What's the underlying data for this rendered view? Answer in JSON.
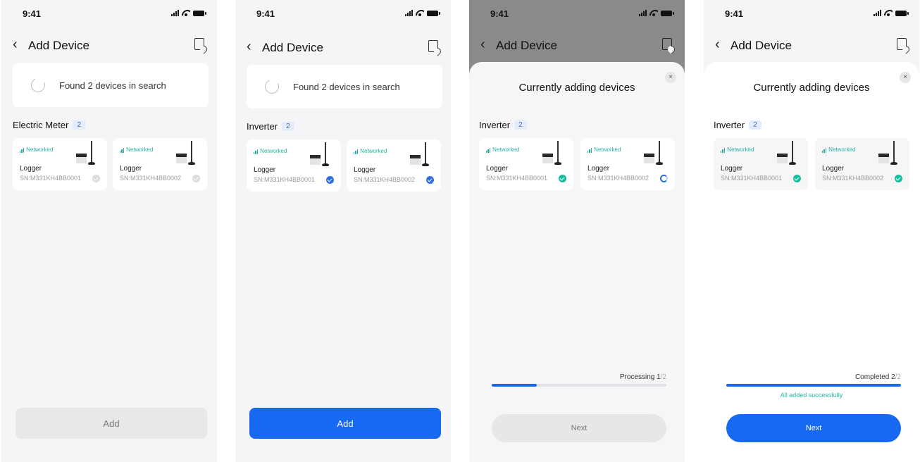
{
  "status_time": "9:41",
  "nav_title": "Add Device",
  "search_text": "Found 2 devices in search",
  "screen1": {
    "group_name": "Electric Meter",
    "group_count": "2",
    "devices": [
      {
        "status": "Networked",
        "name": "Logger",
        "sn": "SN:M331KH4BB0001",
        "state": "unselected"
      },
      {
        "status": "Networked",
        "name": "Logger",
        "sn": "SN:M331KH4BB0002",
        "state": "unselected"
      }
    ],
    "button_label": "Add"
  },
  "screen2": {
    "group_name": "Inverter",
    "group_count": "2",
    "devices": [
      {
        "status": "Networked",
        "name": "Logger",
        "sn": "SN:M331KH4BB0001",
        "state": "selected"
      },
      {
        "status": "Networked",
        "name": "Logger",
        "sn": "SN:M331KH4BB0002",
        "state": "selected"
      }
    ],
    "button_label": "Add"
  },
  "screen3": {
    "sheet_title": "Currently adding devices",
    "close_glyph": "×",
    "group_name": "Inverter",
    "group_count": "2",
    "devices": [
      {
        "status": "Networked",
        "name": "Logger",
        "sn": "SN:M331KH4BB0001",
        "state": "done"
      },
      {
        "status": "Networked",
        "name": "Logger",
        "sn": "SN:M331KH4BB0002",
        "state": "processing"
      }
    ],
    "progress_label": "Processing 1",
    "progress_total": "/2",
    "progress_fraction": 0.26,
    "button_label": "Next"
  },
  "screen4": {
    "sheet_title": "Currently adding devices",
    "close_glyph": "×",
    "group_name": "Inverter",
    "group_count": "2",
    "devices": [
      {
        "status": "Networked",
        "name": "Logger",
        "sn": "SN:M331KH4BB0001",
        "state": "done"
      },
      {
        "status": "Networked",
        "name": "Logger",
        "sn": "SN:M331KH4BB0002",
        "state": "done"
      }
    ],
    "progress_label": "Completed 2",
    "progress_total": "/2",
    "progress_fraction": 1.0,
    "success_text": "All added successfully",
    "button_label": "Next"
  },
  "icons": {
    "back": "chevron-left-icon",
    "scan": "device-scan-icon",
    "signal": "signal-icon",
    "wifi": "wifi-icon",
    "battery": "battery-icon"
  },
  "colors": {
    "primary": "#1769f1",
    "success": "#19bc9f",
    "badge_text": "#3c6ec8",
    "badge_bg": "#e4ecfb"
  }
}
